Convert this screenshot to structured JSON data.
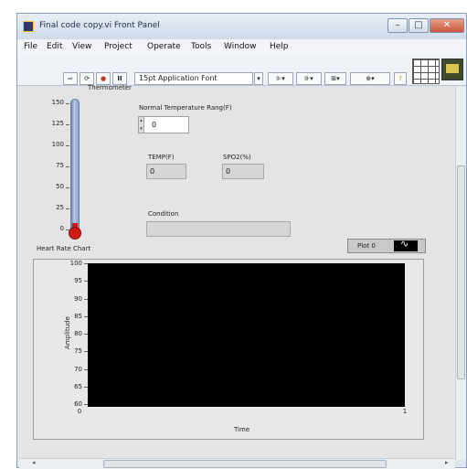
{
  "window": {
    "title": "Final code copy.vi Front Panel",
    "controls": {
      "minimize": "–",
      "maximize": "□",
      "close": "✕"
    }
  },
  "menu": [
    "File",
    "Edit",
    "View",
    "Project",
    "Operate",
    "Tools",
    "Window",
    "Help"
  ],
  "toolbar": {
    "font_selector": "15pt Application Font",
    "run_icon": "run-arrow-icon",
    "run_continuous_icon": "run-continuously-icon",
    "abort_icon": "abort-icon",
    "pause_icon": "pause-icon",
    "pause_label": "II",
    "context_help_label": "?"
  },
  "thermometer": {
    "label": "Thermometer",
    "scale": [
      "150",
      "125",
      "100",
      "75",
      "50",
      "25",
      "0"
    ],
    "value": 0,
    "range": [
      0,
      150
    ],
    "fill_color": "#d21a14"
  },
  "normal_temp": {
    "label": "Normal Temperature Rang(F)",
    "value": "0"
  },
  "temp": {
    "label": "TEMP(F)",
    "value": "0"
  },
  "spo2": {
    "label": "SPO2(%)",
    "value": "0"
  },
  "condition": {
    "label": "Condition",
    "value": ""
  },
  "chart": {
    "label": "Heart Rate Chart",
    "legend": "Plot 0",
    "y_ticks": [
      "100",
      "95",
      "90",
      "85",
      "80",
      "75",
      "70",
      "65",
      "60"
    ],
    "x_ticks": [
      "0",
      "1"
    ],
    "xlabel": "Time",
    "ylabel": "Amplitude",
    "plot_bg": "#000000"
  },
  "chart_data": {
    "type": "line",
    "title": "Heart Rate Chart",
    "xlabel": "Time",
    "ylabel": "Amplitude",
    "xlim": [
      0,
      1
    ],
    "ylim": [
      60,
      100
    ],
    "x_ticks": [
      0,
      1
    ],
    "y_ticks": [
      100,
      95,
      90,
      85,
      80,
      75,
      70,
      65,
      60
    ],
    "series": [
      {
        "name": "Plot 0",
        "values": []
      }
    ],
    "legend": "top-right",
    "grid": false
  }
}
